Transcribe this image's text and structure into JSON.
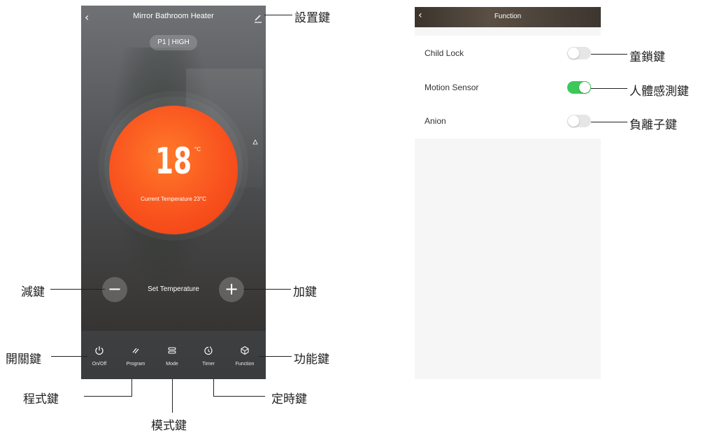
{
  "heater": {
    "title": "Mirror Bathroom Heater",
    "mode_pill": "P1 | HIGH",
    "set_temperature": "18",
    "unit": "°C",
    "current_temperature": "Current Temperature 23°C",
    "set_temperature_label": "Set Temperature",
    "minus": "−",
    "plus": "+",
    "tabs": [
      {
        "label": "On/Off",
        "icon": "power-icon"
      },
      {
        "label": "Program",
        "icon": "program-icon"
      },
      {
        "label": "Mode",
        "icon": "mode-icon"
      },
      {
        "label": "Timer",
        "icon": "timer-icon"
      },
      {
        "label": "Function",
        "icon": "function-icon"
      }
    ]
  },
  "function_screen": {
    "title": "Function",
    "items": [
      {
        "label": "Child Lock",
        "enabled": false
      },
      {
        "label": "Motion Sensor",
        "enabled": true
      },
      {
        "label": "Anion",
        "enabled": false
      }
    ]
  },
  "callouts": {
    "settings": "設置鍵",
    "minus": "減鍵",
    "plus": "加鍵",
    "power": "開關鍵",
    "function": "功能鍵",
    "program": "程式鍵",
    "timer": "定時鍵",
    "mode": "模式鍵",
    "child_lock": "童鎖鍵",
    "motion_sensor": "人體感測鍵",
    "anion": "負離子鍵"
  },
  "colors": {
    "dial": "#f9531e",
    "toggle_on": "#3dc85a",
    "toggle_off": "#e6e6e6"
  }
}
